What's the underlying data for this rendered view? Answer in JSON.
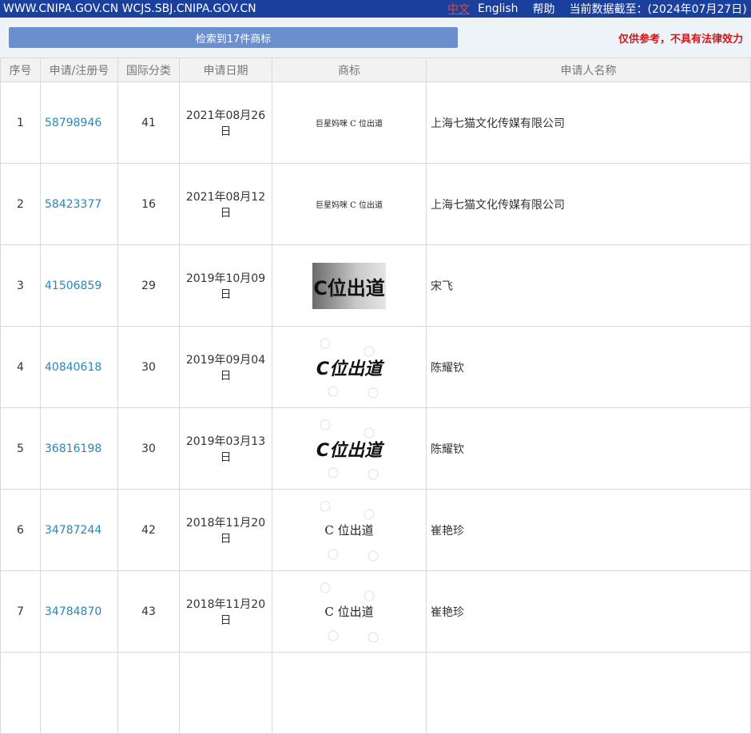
{
  "topbar": {
    "sites": "WWW.CNIPA.GOV.CN WCJS.SBJ.CNIPA.GOV.CN",
    "lang_zh": "中文",
    "lang_en": "English",
    "help": "帮助",
    "data_date": "当前数据截至：(2024年07月27日)"
  },
  "search": {
    "result_label": "检索到17件商标",
    "disclaimer": "仅供参考，不具有法律效力"
  },
  "table": {
    "headers": [
      "序号",
      "申请/注册号",
      "国际分类",
      "申请日期",
      "商标",
      "申请人名称"
    ],
    "rows": [
      {
        "seq": "1",
        "reg_no": "58798946",
        "class": "41",
        "date": "2021年08月26日",
        "mark_text": "巨星妈咪 C 位出道",
        "applicant": "上海七猫文化传媒有限公司"
      },
      {
        "seq": "2",
        "reg_no": "58423377",
        "class": "16",
        "date": "2021年08月12日",
        "mark_text": "巨星妈咪 C 位出道",
        "applicant": "上海七猫文化传媒有限公司"
      },
      {
        "seq": "3",
        "reg_no": "41506859",
        "class": "29",
        "date": "2019年10月09日",
        "mark_text": "C位出道",
        "applicant": "宋飞"
      },
      {
        "seq": "4",
        "reg_no": "40840618",
        "class": "30",
        "date": "2019年09月04日",
        "mark_text": "C位出道",
        "applicant": "陈耀钦"
      },
      {
        "seq": "5",
        "reg_no": "36816198",
        "class": "30",
        "date": "2019年03月13日",
        "mark_text": "C位出道",
        "applicant": "陈耀钦"
      },
      {
        "seq": "6",
        "reg_no": "34787244",
        "class": "42",
        "date": "2018年11月20日",
        "mark_text": "C 位出道",
        "applicant": "崔艳珍"
      },
      {
        "seq": "7",
        "reg_no": "34784870",
        "class": "43",
        "date": "2018年11月20日",
        "mark_text": "C 位出道",
        "applicant": "崔艳珍"
      },
      {
        "seq": "",
        "reg_no": "",
        "class": "",
        "date": "",
        "mark_text": "",
        "applicant": ""
      }
    ]
  }
}
